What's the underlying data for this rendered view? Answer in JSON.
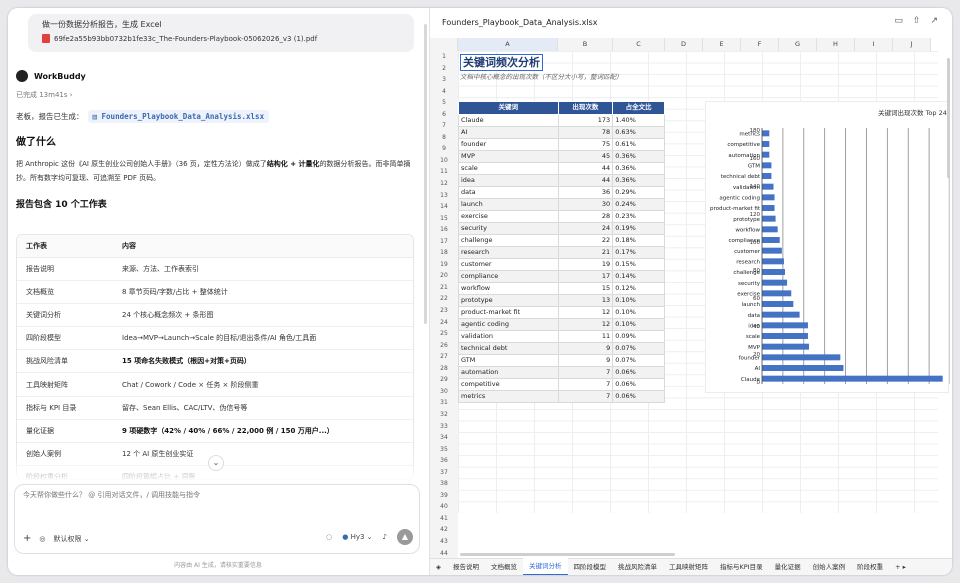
{
  "chat": {
    "user_message": "做一份数据分析报告，生成 Excel",
    "attachment": "69fe2a55b93bb0732b1fe33c_The-Founders-Playbook-05062026_v3 (1).pdf",
    "bot_name": "WorkBuddy",
    "done_status": "已完成 13m41s ›",
    "generated_prefix": "老板，报告已生成：",
    "generated_file": "Founders_Playbook_Data_Analysis.xlsx",
    "h_what": "做了什么",
    "para_1": "把 Anthropic 这份《AI 原生创业公司创始人手册》（36 页，定性方法论）做成了",
    "para_bold": "结构化 + 计量化",
    "para_2": "的数据分析报告。而非简单摘抄。所有数字均可复现、可追溯至 PDF 页码。",
    "h_report": "报告包含 10 个工作表",
    "table_headers": [
      "工作表",
      "内容"
    ],
    "table_rows": [
      [
        "报告说明",
        "来源、方法、工作表索引",
        false
      ],
      [
        "文档概览",
        "8 章节页码/字数/占比 + 整体统计",
        false
      ],
      [
        "关键词分析",
        "24 个核心概念频次 + 条形图",
        false
      ],
      [
        "四阶段模型",
        "Idea→MVP→Launch→Scale 的目标/退出条件/AI 角色/工具面",
        false
      ],
      [
        "挑战风险清单",
        "15 项命名失败模式（根因+对策+页码）",
        true
      ],
      [
        "工具映射矩阵",
        "Chat / Cowork / Code × 任务 × 阶段侧重",
        false
      ],
      [
        "指标与 KPI 目录",
        "留存、Sean Ellis、CAC/LTV、伪信号等",
        false
      ],
      [
        "量化证据",
        "9 项硬数字（42% / 40% / 66% / 22,000 例 / 150 万用户...）",
        true
      ],
      [
        "创始人案例",
        "12 个 AI 原生创业实证",
        false
      ],
      [
        "阶段权重分析",
        "四阶段篇幅占比 + 洞察",
        false
      ]
    ],
    "input_placeholder": "今天帮你做些什么？ @ 引用对话文件，/ 调用技能与指令",
    "permission": "默认权限 ⌄",
    "model": "Hy3 ⌄",
    "disclaimer": "内容由 AI 生成，请核实重要信息"
  },
  "sheet": {
    "file_title": "Founders_Playbook_Data_Analysis.xlsx",
    "columns": [
      "A",
      "B",
      "C",
      "D",
      "E",
      "F",
      "G",
      "H",
      "I",
      "J"
    ],
    "title": "关键词频次分析",
    "subtitle": "文档中核心概念的出现次数（不区分大小写，整词匹配）",
    "headers": [
      "关键词",
      "出现次数",
      "占全文比"
    ],
    "rows": [
      [
        "Claude",
        "173",
        "1.40%"
      ],
      [
        "AI",
        "78",
        "0.63%"
      ],
      [
        "founder",
        "75",
        "0.61%"
      ],
      [
        "MVP",
        "45",
        "0.36%"
      ],
      [
        "scale",
        "44",
        "0.36%"
      ],
      [
        "idea",
        "44",
        "0.36%"
      ],
      [
        "data",
        "36",
        "0.29%"
      ],
      [
        "launch",
        "30",
        "0.24%"
      ],
      [
        "exercise",
        "28",
        "0.23%"
      ],
      [
        "security",
        "24",
        "0.19%"
      ],
      [
        "challenge",
        "22",
        "0.18%"
      ],
      [
        "research",
        "21",
        "0.17%"
      ],
      [
        "customer",
        "19",
        "0.15%"
      ],
      [
        "compliance",
        "17",
        "0.14%"
      ],
      [
        "workflow",
        "15",
        "0.12%"
      ],
      [
        "prototype",
        "13",
        "0.10%"
      ],
      [
        "product-market fit",
        "12",
        "0.10%"
      ],
      [
        "agentic coding",
        "12",
        "0.10%"
      ],
      [
        "validation",
        "11",
        "0.09%"
      ],
      [
        "technical debt",
        "9",
        "0.07%"
      ],
      [
        "GTM",
        "9",
        "0.07%"
      ],
      [
        "automation",
        "7",
        "0.06%"
      ],
      [
        "competitive",
        "7",
        "0.06%"
      ],
      [
        "metrics",
        "7",
        "0.06%"
      ]
    ],
    "tabs": [
      "报告说明",
      "文档概览",
      "关键词分析",
      "四阶段模型",
      "挑战风险清单",
      "工具映射矩阵",
      "指标与KPI目录",
      "量化证据",
      "创始人案例",
      "阶段权重"
    ],
    "active_tab": 2
  },
  "chart_data": {
    "type": "bar",
    "orientation": "horizontal",
    "title": "关键词出现次数 Top 24",
    "categories": [
      "metrics",
      "competitive",
      "automation",
      "GTM",
      "technical debt",
      "validation",
      "agentic coding",
      "product-market fit",
      "prototype",
      "workflow",
      "compliance",
      "customer",
      "research",
      "challenge",
      "security",
      "exercise",
      "launch",
      "data",
      "idea",
      "scale",
      "MVP",
      "founder",
      "AI",
      "Claude"
    ],
    "values": [
      7,
      7,
      7,
      9,
      9,
      11,
      12,
      12,
      13,
      15,
      17,
      19,
      21,
      22,
      24,
      28,
      30,
      36,
      44,
      44,
      45,
      75,
      78,
      173
    ],
    "axis_ticks": [
      0,
      20,
      40,
      60,
      80,
      100,
      120,
      140,
      160,
      180
    ],
    "xlim": [
      0,
      180
    ],
    "bar_color": "#4472c4",
    "grid": true
  }
}
